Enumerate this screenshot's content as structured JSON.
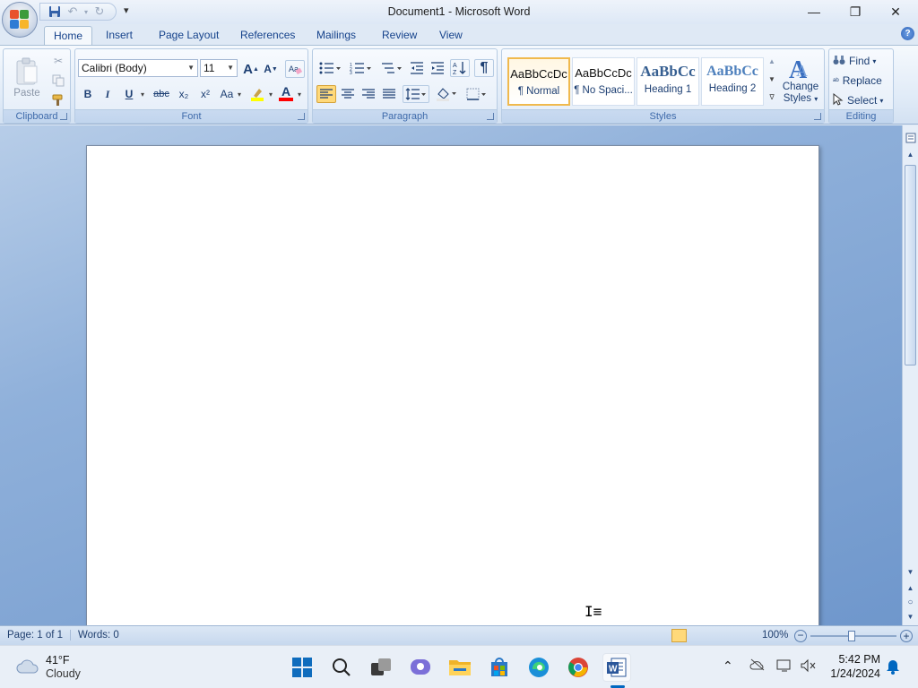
{
  "window": {
    "title": "Document1 - Microsoft Word"
  },
  "qat": {
    "more_glyph": "▾"
  },
  "tabs": [
    {
      "label": "Home",
      "active": true
    },
    {
      "label": "Insert"
    },
    {
      "label": "Page Layout"
    },
    {
      "label": "References"
    },
    {
      "label": "Mailings"
    },
    {
      "label": "Review"
    },
    {
      "label": "View"
    }
  ],
  "ribbon": {
    "clipboard": {
      "label": "Clipboard",
      "paste": "Paste"
    },
    "font": {
      "label": "Font",
      "name": "Calibri (Body)",
      "size": "11",
      "bold": "B",
      "italic": "I",
      "underline": "U",
      "strike": "abc",
      "subscript": "x₂",
      "superscript": "x²",
      "case": "Aa",
      "grow": "A",
      "shrink": "A",
      "highlight_color": "#ffff00",
      "font_color": "#ff0000"
    },
    "paragraph": {
      "label": "Paragraph",
      "pilcrow": "¶"
    },
    "styles": {
      "label": "Styles",
      "items": [
        {
          "sample": "AaBbCcDc",
          "name": "¶ Normal",
          "selected": true
        },
        {
          "sample": "AaBbCcDc",
          "name": "¶ No Spaci..."
        },
        {
          "sample": "AaBbCc",
          "name": "Heading 1"
        },
        {
          "sample": "AaBbCc",
          "name": "Heading 2"
        }
      ],
      "change_styles_1": "Change",
      "change_styles_2": "Styles"
    },
    "editing": {
      "label": "Editing",
      "find": "Find",
      "replace": "Replace",
      "select": "Select"
    }
  },
  "status": {
    "page": "Page: 1 of 1",
    "words": "Words: 0",
    "zoom": "100%"
  },
  "taskbar": {
    "weather_temp": "41°F",
    "weather_desc": "Cloudy",
    "time": "5:42 PM",
    "date": "1/24/2024"
  },
  "colors": {
    "accent": "#0067c0",
    "ribbon_text": "#15428b"
  }
}
